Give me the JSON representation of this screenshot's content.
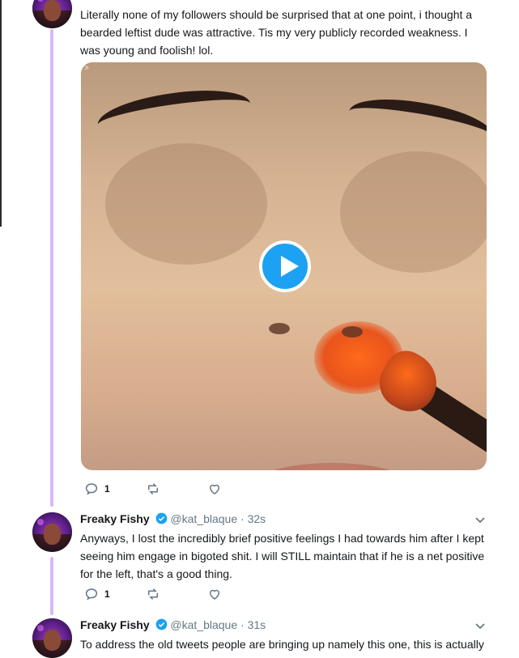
{
  "thread": {
    "tweet1": {
      "text": "Literally none of my followers should be surprised that at one point, i thought a bearded leftist dude was attractive. Tis my very publicly recorded weakness. I was young and foolish! lol.",
      "media_label": ">",
      "replies": "1",
      "retweets": "",
      "likes": ""
    },
    "tweet2": {
      "name": "Freaky Fishy",
      "handle": "@kat_blaque",
      "separator": "·",
      "time": "32s",
      "text": "Anyways, I lost the incredibly brief positive feelings I had towards him after I kept seeing him engage in bigoted shit. I will STILL maintain that if he is a net positive for the left, that's a good thing.",
      "replies": "1"
    },
    "tweet3": {
      "name": "Freaky Fishy",
      "handle": "@kat_blaque",
      "separator": "·",
      "time": "31s",
      "text": "To address the old tweets people are bringing up namely this one, this is actually"
    }
  },
  "colors": {
    "thread_line": "#d7b9f5",
    "accent": "#1da1f2",
    "muted": "#657786"
  },
  "icons": [
    "reply-icon",
    "retweet-icon",
    "like-icon",
    "verified-icon",
    "chevron-down-icon",
    "play-icon"
  ]
}
